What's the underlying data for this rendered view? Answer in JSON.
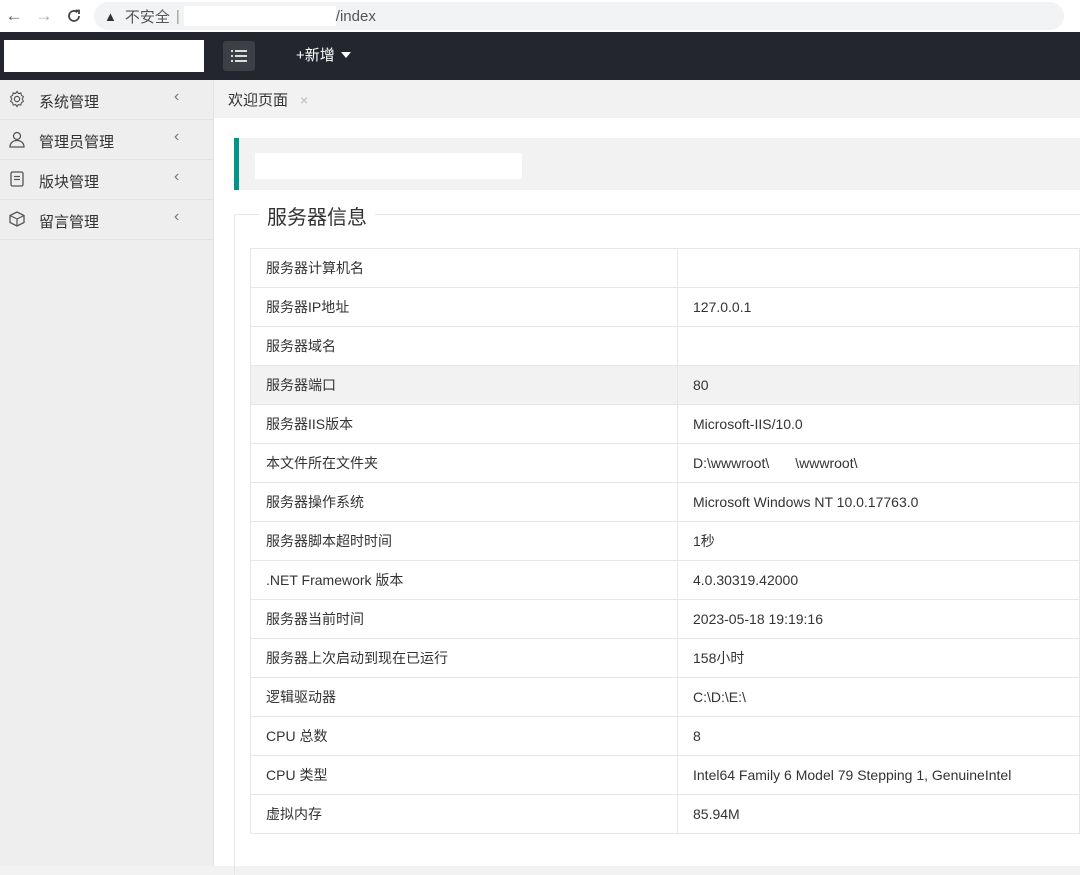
{
  "browser": {
    "insecure_label": "不安全",
    "separator": "|",
    "url_path": "/index"
  },
  "header": {
    "add_label": "+新增"
  },
  "sidebar": {
    "items": [
      {
        "label": "系统管理",
        "icon": "gear-icon"
      },
      {
        "label": "管理员管理",
        "icon": "user-icon"
      },
      {
        "label": "版块管理",
        "icon": "document-icon"
      },
      {
        "label": "留言管理",
        "icon": "box-icon"
      }
    ]
  },
  "tabs": [
    {
      "label": "欢迎页面",
      "close": "×"
    }
  ],
  "section": {
    "title": "服务器信息"
  },
  "server_info": [
    {
      "key": "服务器计算机名",
      "value": ""
    },
    {
      "key": "服务器IP地址",
      "value": "127.0.0.1"
    },
    {
      "key": "服务器域名",
      "value": ""
    },
    {
      "key": "服务器端口",
      "value": "80"
    },
    {
      "key": "服务器IIS版本",
      "value": "Microsoft-IIS/10.0"
    },
    {
      "key": "本文件所在文件夹",
      "value_parts": [
        "D:\\wwwroot\\",
        "\\wwwroot\\"
      ]
    },
    {
      "key": "服务器操作系统",
      "value": "Microsoft Windows NT 10.0.17763.0"
    },
    {
      "key": "服务器脚本超时时间",
      "value": "1秒"
    },
    {
      "key": ".NET Framework 版本",
      "value": "4.0.30319.42000"
    },
    {
      "key": "服务器当前时间",
      "value": "2023-05-18 19:19:16"
    },
    {
      "key": "服务器上次启动到现在已运行",
      "value": "158小时"
    },
    {
      "key": "逻辑驱动器",
      "value": "C:\\D:\\E:\\"
    },
    {
      "key": "CPU 总数",
      "value": "8"
    },
    {
      "key": "CPU 类型",
      "value": "Intel64 Family 6 Model 79 Stepping 1, GenuineIntel"
    },
    {
      "key": "虚拟内存",
      "value": "85.94M"
    }
  ]
}
